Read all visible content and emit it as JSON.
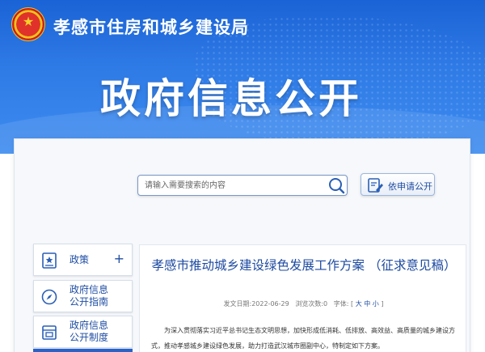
{
  "header": {
    "org_title": "孝感市住房和城乡建设局",
    "main_title": "政府信息公开"
  },
  "search": {
    "placeholder": "请输入需要搜索的内容"
  },
  "apply_button": {
    "label": "依申请公开"
  },
  "sidebar": {
    "items": [
      {
        "label": "政策",
        "has_plus": "+"
      },
      {
        "label_line1": "政府信息",
        "label_line2": "公开指南"
      },
      {
        "label_line1": "政府信息",
        "label_line2": "公开制度"
      }
    ]
  },
  "article": {
    "title": "孝感市推动城乡建设绿色发展工作方案 （征求意见稿）",
    "meta_date": "发文日期:2022-06-29",
    "meta_views": "浏览次数:0",
    "meta_font": "字体:",
    "font_sizes": [
      "大",
      "中",
      "小"
    ],
    "body": "为深入贯彻落实习近平总书记生态文明思想，加快形成低消耗、低排放、高效益、高质量的城乡建设方式，推动孝感城乡建设绿色发展，助力打造武汉城市圈副中心，特制定如下方案。"
  },
  "colors": {
    "banner": "#2f7be6",
    "accent": "#1d4aa0",
    "sidebar_active": "#2a62c8"
  }
}
